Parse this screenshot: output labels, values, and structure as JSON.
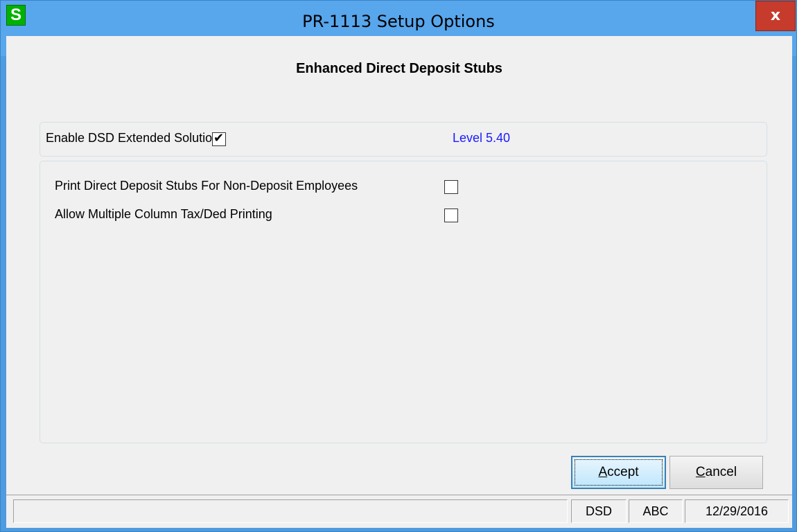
{
  "window": {
    "title": "PR-1113 Setup Options",
    "app_icon_letter": "S",
    "close_glyph": "x"
  },
  "heading": "Enhanced Direct Deposit Stubs",
  "extended_solution": {
    "label": "Enable DSD Extended Solution",
    "checked": true,
    "level_text": "Level  5.40"
  },
  "options": [
    {
      "label": "Print Direct Deposit Stubs For Non-Deposit Employees",
      "checked": false
    },
    {
      "label": "Allow Multiple Column Tax/Ded Printing",
      "checked": false
    }
  ],
  "buttons": {
    "accept_mnemonic": "A",
    "accept_rest": "ccept",
    "cancel_mnemonic": "C",
    "cancel_rest": "ancel"
  },
  "status_bar": {
    "message": "",
    "company_module": "DSD",
    "company_code": "ABC",
    "date": "12/29/2016"
  },
  "colors": {
    "title_bar": "#58a6ec",
    "close_button": "#c63b2b",
    "level_text": "#1a1aff",
    "app_icon": "#00b200"
  },
  "icons": {
    "app": "sage-s-icon",
    "close": "close-icon",
    "check": "checkmark-icon"
  }
}
